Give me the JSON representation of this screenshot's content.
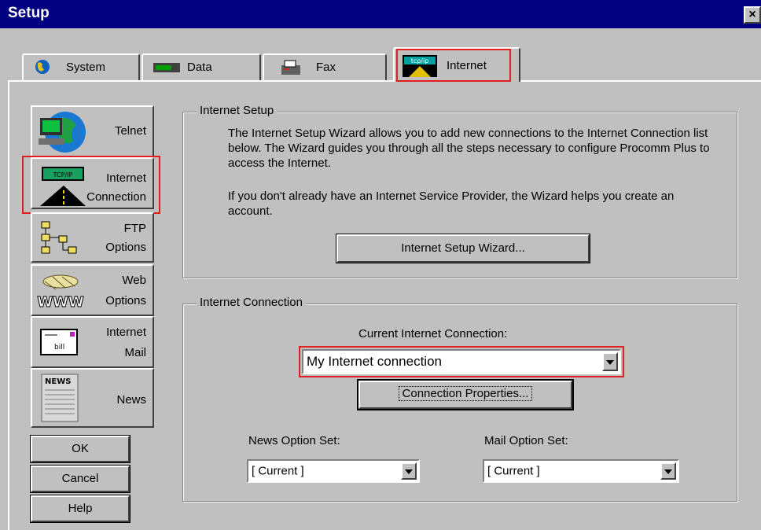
{
  "window": {
    "title": "Setup",
    "close": "×"
  },
  "tabs": [
    {
      "label": "System",
      "underline": "y"
    },
    {
      "label": "Data",
      "underline": "D"
    },
    {
      "label": "Fax",
      "underline": "x"
    },
    {
      "label": "Internet",
      "underline": "I",
      "icon_text": "tcp/ip",
      "active": true
    }
  ],
  "categories": [
    {
      "label1": "Telnet",
      "label2": ""
    },
    {
      "label1": "Internet",
      "label2": "Connection",
      "selected": true,
      "icon_text": "TCP/IP"
    },
    {
      "label1": "FTP",
      "label2": "Options"
    },
    {
      "label1": "Web",
      "label2": "Options",
      "icon_text": "WWW"
    },
    {
      "label1": "Internet",
      "label2": "Mail",
      "icon_text": "bill"
    },
    {
      "label1": "",
      "label2": "News",
      "icon_text": "NEWS"
    }
  ],
  "buttons": {
    "ok": "OK",
    "cancel": "Cancel",
    "help": "Help"
  },
  "internet_setup": {
    "group_label": "Internet Setup",
    "para1": "The Internet Setup Wizard allows you to add new connections to the Internet Connection list below. The Wizard guides you through all the steps necessary to configure Procomm Plus to access the Internet.",
    "para2": "If you don't already have an Internet Service Provider, the Wizard helps you create an account.",
    "wizard_button": "Internet Setup Wizard..."
  },
  "internet_connection": {
    "group_label": "Internet Connection",
    "current_label": "Current Internet Connection:",
    "current_value": "My Internet connection",
    "properties_button": "Connection Properties...",
    "news_label": "News Option Set:",
    "news_value": "[ Current ]",
    "mail_label": "Mail Option Set:",
    "mail_value": "[ Current ]"
  },
  "colors": {
    "titlebar": "#000080",
    "highlight": "#e02020",
    "face": "#c0c0c0"
  }
}
